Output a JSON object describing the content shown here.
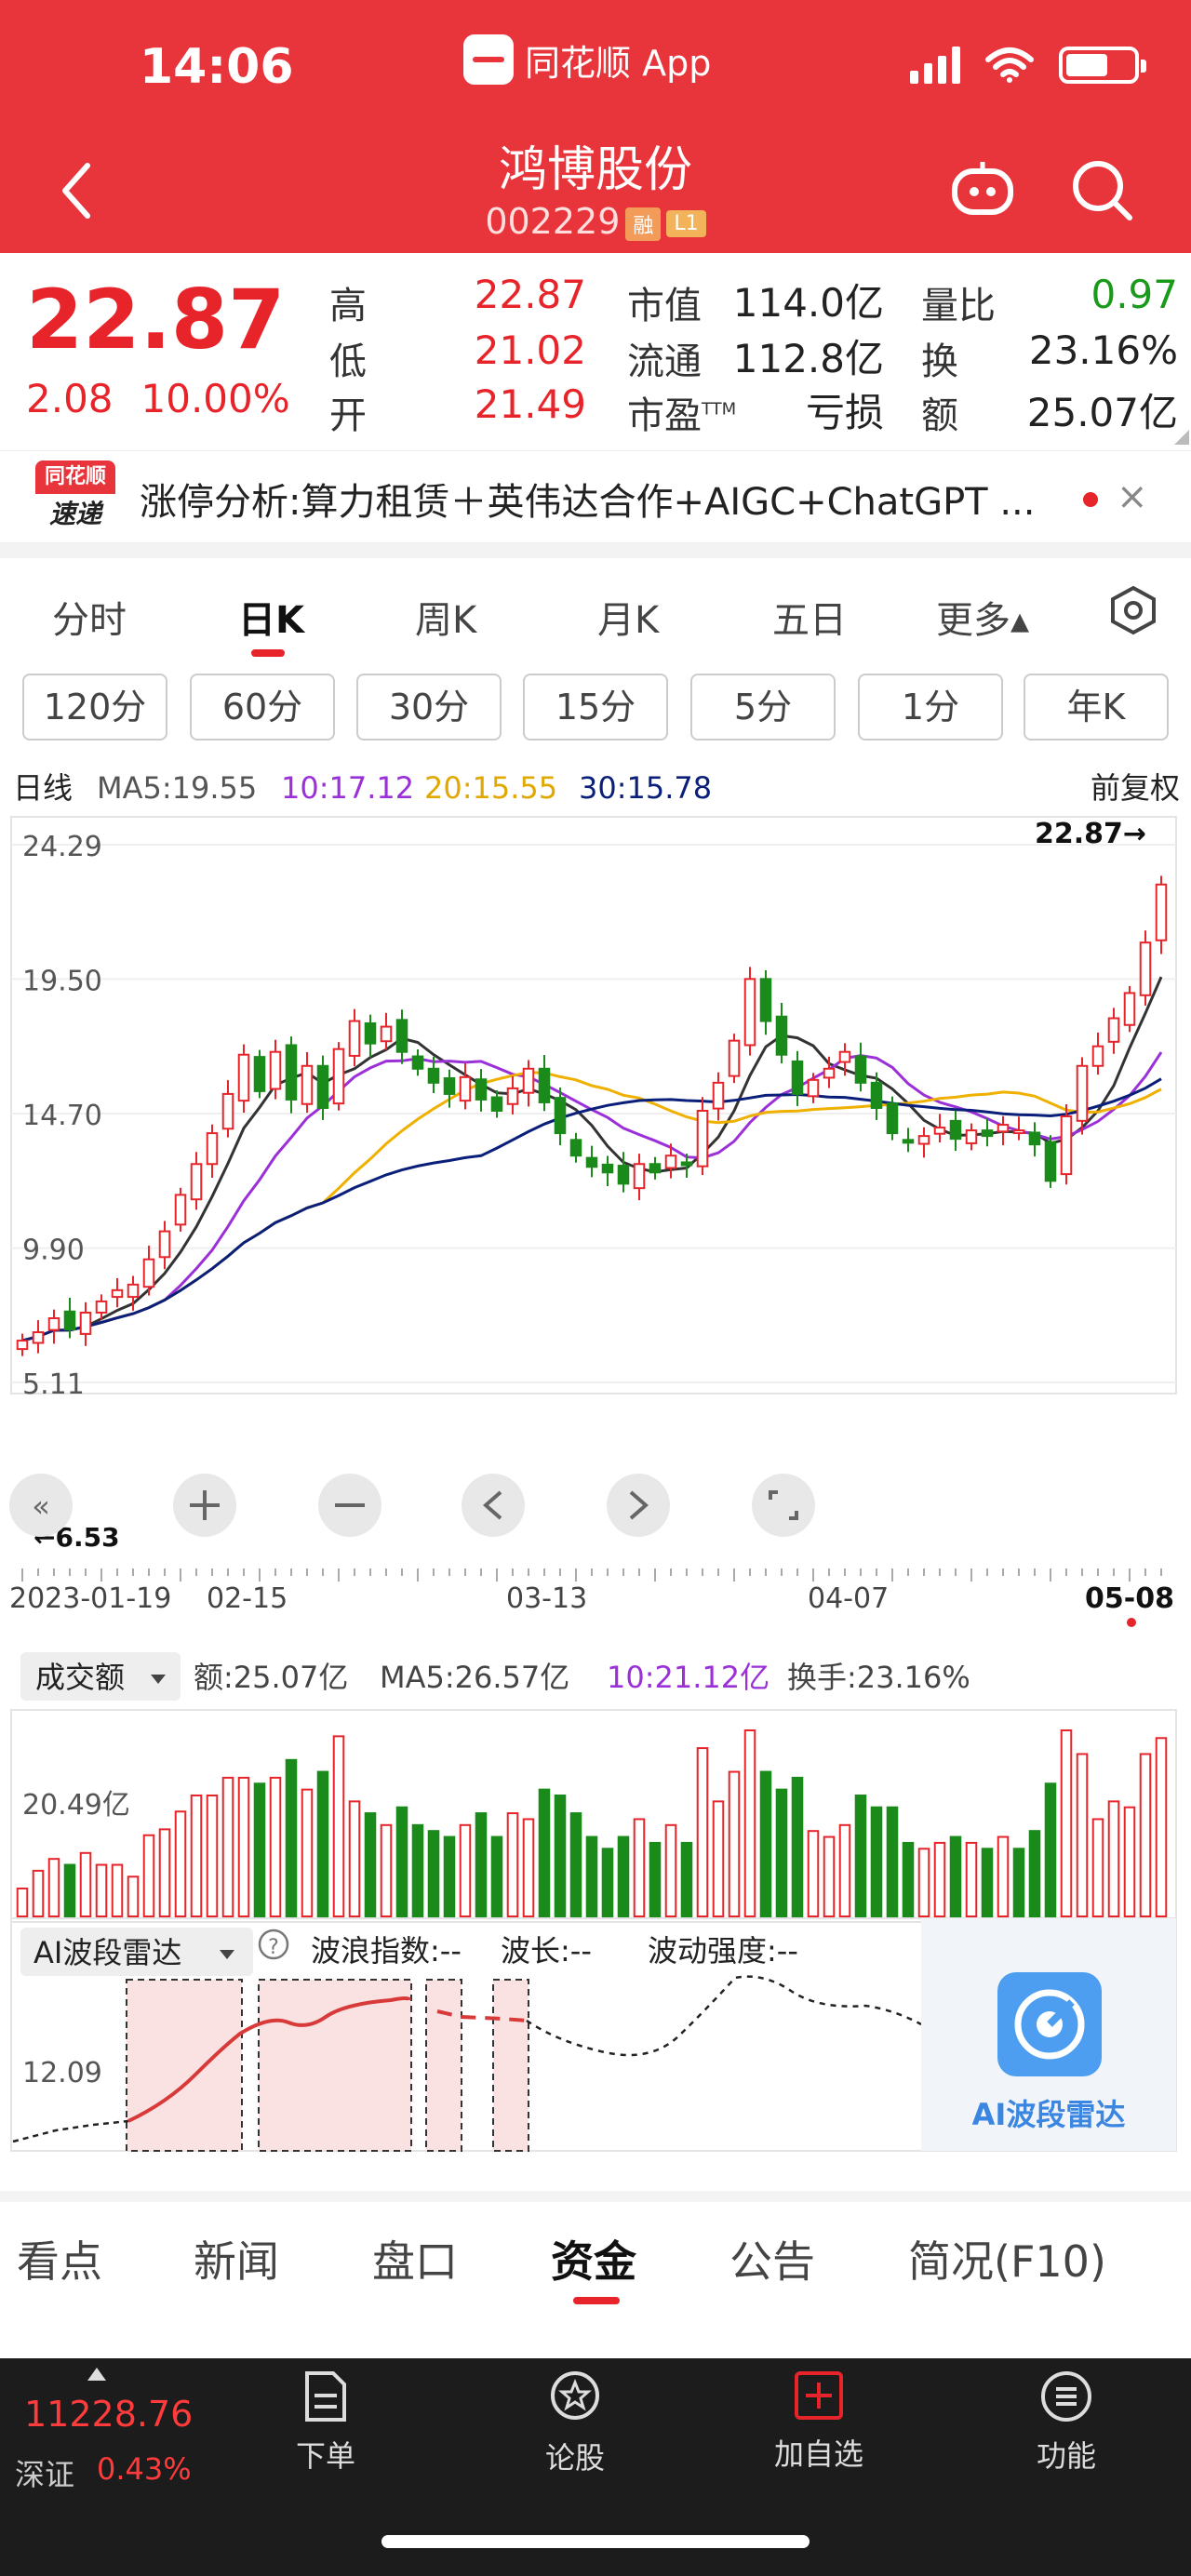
{
  "status": {
    "time": "14:06",
    "app_name": "同花顺 App"
  },
  "header": {
    "stock_name": "鸿博股份",
    "stock_code": "002229",
    "tag_rong": "融",
    "tag_level": "L1"
  },
  "quote": {
    "price": "22.87",
    "change": "2.08",
    "change_pct": "10.00%",
    "rows": [
      {
        "l1": "高",
        "v1": "22.87",
        "l2": "市值",
        "v2": "114.0亿",
        "l3": "量比",
        "v3": "0.97"
      },
      {
        "l1": "低",
        "v1": "21.02",
        "l2": "流通",
        "v2": "112.8亿",
        "l3": "换",
        "v3": "23.16%"
      },
      {
        "l1": "开",
        "v1": "21.49",
        "l2": "市盈",
        "l2_sup": "TTM",
        "v2": "亏损",
        "l3": "额",
        "v3": "25.07亿"
      }
    ]
  },
  "news": {
    "logo_top": "同花顺",
    "logo_bottom": "速递",
    "text": "涨停分析:算力租赁＋英伟达合作+AIGC+ChatGPT ...",
    "close": "×"
  },
  "period_tabs": [
    "分时",
    "日K",
    "周K",
    "月K",
    "五日",
    "更多▴"
  ],
  "active_period": "日K",
  "minute_buttons": [
    "120分",
    "60分",
    "30分",
    "15分",
    "5分",
    "1分",
    "年K"
  ],
  "ma_legend": {
    "label": "日线",
    "ma5": "MA5:19.55",
    "ma10": "10:17.12",
    "ma20": "20:15.55",
    "ma30": "30:15.78",
    "adjust": "前复权"
  },
  "price_axis": [
    "24.29",
    "19.50",
    "14.70",
    "9.90",
    "5.11"
  ],
  "last_price_marker": "22.87→",
  "low_marker": "←6.53",
  "dates": [
    "2023-01-19",
    "02-15",
    "03-13",
    "04-07",
    "05-08"
  ],
  "volume": {
    "selector": "成交额",
    "amount": "额:25.07亿",
    "ma5": "MA5:26.57亿",
    "ma10": "10:21.12亿",
    "turnover": "换手:23.16%",
    "axis": "20.49亿"
  },
  "ai_radar": {
    "selector": "AI波段雷达",
    "help": "?",
    "wave_index": "波浪指数:--",
    "wave_length": "波长:--",
    "intensity": "波动强度:--",
    "axis": "12.09",
    "button_label": "AI波段雷达"
  },
  "chart_data": {
    "type": "candlestick",
    "price_axis_ticks": [
      24.29,
      19.5,
      14.7,
      9.9,
      5.11
    ],
    "ylim": [
      5.11,
      24.29
    ],
    "x_ticks": [
      "2023-01-19",
      "02-15",
      "03-13",
      "04-07",
      "05-08"
    ],
    "candles_close": [
      6.6,
      6.9,
      7.4,
      7.0,
      7.6,
      8.0,
      8.4,
      8.6,
      9.5,
      10.5,
      11.8,
      12.9,
      14.0,
      15.4,
      16.8,
      15.5,
      16.9,
      15.2,
      16.4,
      14.9,
      17.0,
      18.0,
      17.2,
      17.8,
      16.9,
      16.3,
      15.8,
      15.4,
      16.0,
      15.2,
      14.8,
      15.6,
      16.3,
      15.1,
      14.0,
      13.2,
      12.8,
      12.6,
      12.2,
      12.9,
      12.6,
      13.2,
      12.9,
      14.8,
      15.8,
      17.3,
      19.5,
      18.0,
      16.8,
      15.4,
      15.9,
      16.3,
      16.9,
      15.8,
      14.9,
      14.0,
      13.7,
      13.9,
      14.2,
      13.8,
      14.1,
      13.9,
      14.3,
      14.1,
      13.6,
      12.3,
      14.6,
      16.4,
      17.1,
      18.1,
      19.0,
      20.8,
      22.87
    ],
    "ma5": "19.55",
    "ma10": "17.12",
    "ma20": "15.55",
    "ma30": "15.78",
    "volume_ma": {
      "ma5": "26.57亿",
      "ma10": "21.12亿"
    }
  },
  "info_tabs": [
    "看点",
    "新闻",
    "盘口",
    "资金",
    "公告",
    "简况(F10)"
  ],
  "active_info_tab": "资金",
  "bottom_nav": {
    "index_value": "11228.76",
    "index_name": "深证",
    "index_pct": "0.43%",
    "items": [
      {
        "label": "下单",
        "icon": "order-icon"
      },
      {
        "label": "论股",
        "icon": "discuss-icon"
      },
      {
        "label": "加自选",
        "icon": "add-watch-icon"
      },
      {
        "label": "功能",
        "icon": "menu-icon"
      }
    ]
  },
  "colors": {
    "brand": "#e8353b",
    "up": "#e8242b",
    "down": "#1a8a1a",
    "ma5": "#333333",
    "ma10": "#9b30d9",
    "ma20": "#f0b000",
    "ma30": "#0a1f7a"
  }
}
